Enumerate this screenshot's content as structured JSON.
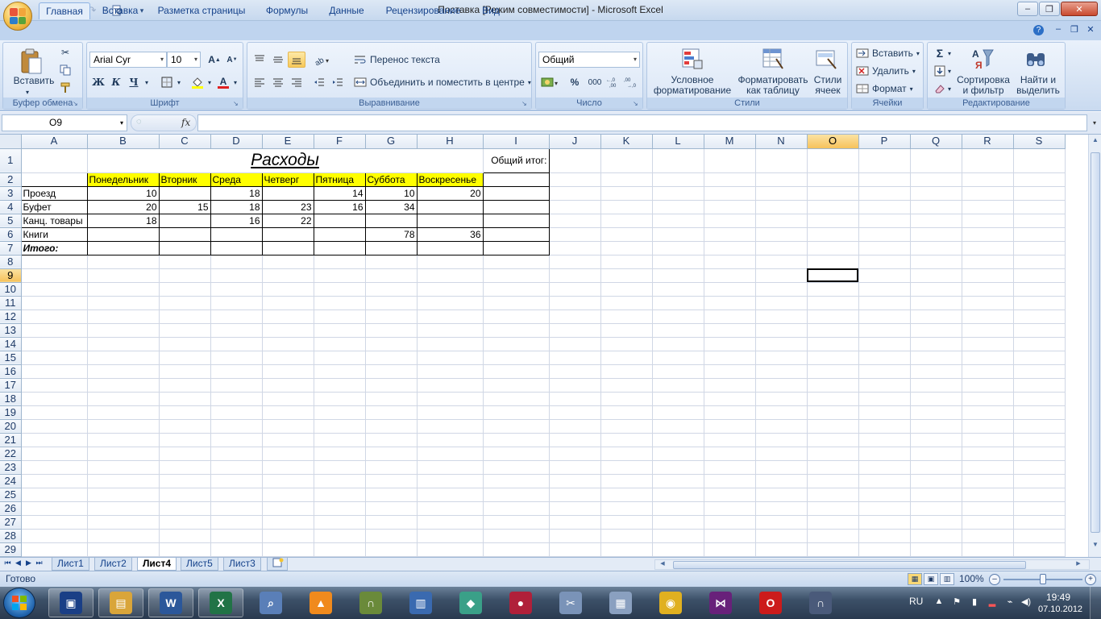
{
  "window": {
    "title": "Поставка  [Режим совместимости] - Microsoft Excel",
    "minimize": "–",
    "maximize": "❐",
    "close": "✕"
  },
  "ribbon_tabs": [
    "Главная",
    "Вставка",
    "Разметка страницы",
    "Формулы",
    "Данные",
    "Рецензирование",
    "Вид"
  ],
  "ribbon": {
    "clipboard": {
      "label": "Буфер обмена",
      "paste": "Вставить"
    },
    "font": {
      "label": "Шрифт",
      "name": "Arial Cyr",
      "size": "10",
      "bold": "Ж",
      "italic": "К",
      "underline": "Ч"
    },
    "alignment": {
      "label": "Выравнивание",
      "wrap": "Перенос текста",
      "merge": "Объединить и поместить в центре"
    },
    "number": {
      "label": "Число",
      "format": "Общий",
      "percent": "%",
      "thousands": "000"
    },
    "styles": {
      "label": "Стили",
      "conditional": [
        "Условное",
        "форматирование"
      ],
      "table": [
        "Форматировать",
        "как таблицу"
      ],
      "cell": [
        "Стили",
        "ячеек"
      ]
    },
    "cells": {
      "label": "Ячейки",
      "insert": "Вставить",
      "delete": "Удалить",
      "format": "Формат"
    },
    "editing": {
      "label": "Редактирование",
      "sort": [
        "Сортировка",
        "и фильтр"
      ],
      "find": [
        "Найти и",
        "выделить"
      ]
    }
  },
  "formula_bar": {
    "name_box": "O9",
    "fx": "fx",
    "formula": ""
  },
  "sheet": {
    "columns": [
      "A",
      "B",
      "C",
      "D",
      "E",
      "F",
      "G",
      "H",
      "I",
      "J",
      "K",
      "L",
      "M",
      "N",
      "O",
      "P",
      "Q",
      "R",
      "S"
    ],
    "selected_column": "O",
    "selected_row": 9,
    "rows": 29,
    "title": "Расходы",
    "total_header": "Общий итог:",
    "days": [
      "Понедельник",
      "Вторник",
      "Среда",
      "Четверг",
      "Пятница",
      "Суббота",
      "Воскресенье"
    ],
    "data_rows": [
      {
        "label": "Проезд",
        "values": [
          "10",
          "",
          "18",
          "",
          "14",
          "10",
          "20"
        ]
      },
      {
        "label": "Буфет",
        "values": [
          "20",
          "15",
          "18",
          "23",
          "16",
          "34",
          ""
        ]
      },
      {
        "label": "Канц. товары",
        "values": [
          "18",
          "",
          "16",
          "22",
          "",
          "",
          ""
        ]
      },
      {
        "label": "Книги",
        "values": [
          "",
          "",
          "",
          "",
          "",
          "78",
          "36"
        ]
      }
    ],
    "total_label": "Итого:"
  },
  "sheet_tabs": [
    "Лист1",
    "Лист2",
    "Лист4",
    "Лист5",
    "Лист3"
  ],
  "active_sheet": "Лист4",
  "status": {
    "text": "Готово",
    "zoom": "100%"
  },
  "taskbar": {
    "lang": "RU",
    "time": "19:49",
    "date": "07.10.2012",
    "apps": [
      "save-app",
      "explorer-app",
      "word-app",
      "excel-app",
      "search-app",
      "avast-app",
      "app-arch",
      "app-buildings",
      "app-diamond",
      "app-grapes",
      "app-scissors",
      "calculator-app",
      "chrome-app",
      "visual-studio-app",
      "opera-app",
      "arch-app-2"
    ]
  },
  "colors": {
    "header_yellow": "#ffff00",
    "ribbon_blue": "#dae6f6",
    "taskbar": "#2a3a4f"
  }
}
